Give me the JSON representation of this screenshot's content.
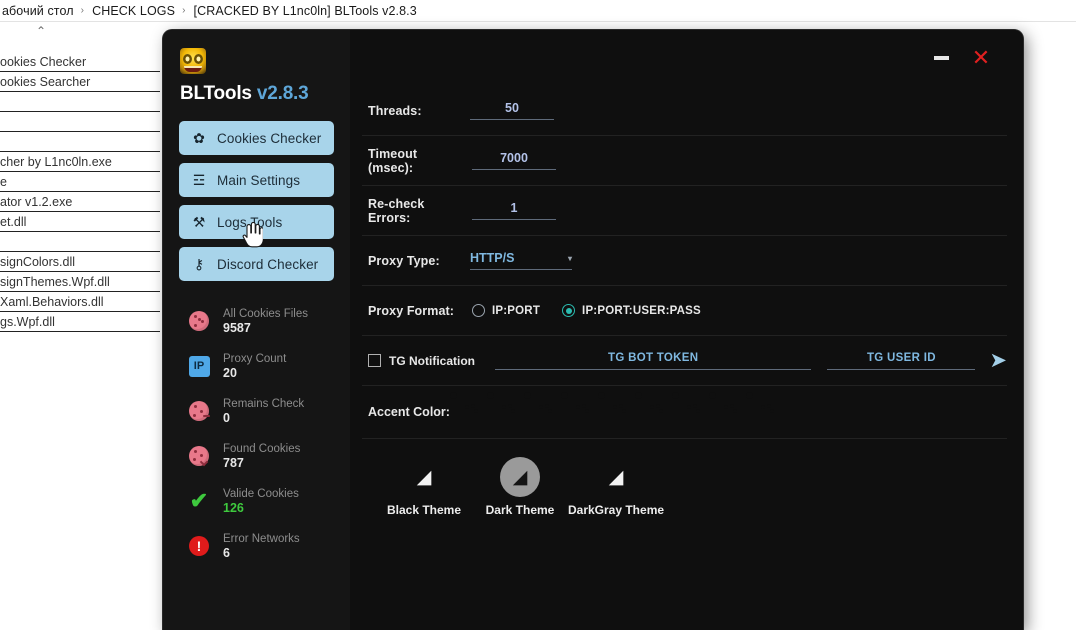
{
  "explorer": {
    "breadcrumb": [
      "абочий стол",
      "CHECK LOGS",
      "[CRACKED BY L1nc0ln] BLTools v2.8.3"
    ],
    "separator": "›",
    "collapse_icon": "⌃",
    "files": [
      "ookies Checker",
      "ookies Searcher",
      "",
      "",
      "",
      "cher by L1nc0ln.exe",
      "e",
      "ator v1.2.exe",
      "et.dll",
      "",
      "signColors.dll",
      "signThemes.Wpf.dll",
      "Xaml.Behaviors.dll",
      "gs.Wpf.dll"
    ]
  },
  "app": {
    "logo_icon": "emoji-face-icon",
    "title": "BLTools",
    "version": "v2.8.3",
    "window_controls": {
      "minimize": "minimize-icon",
      "close": "✕"
    },
    "nav": [
      {
        "label": "Cookies Checker",
        "icon": "✿",
        "icon_name": "cookie-icon"
      },
      {
        "label": "Main Settings",
        "icon": "☲",
        "icon_name": "sliders-icon"
      },
      {
        "label": "Logs Tools",
        "icon": "⚒",
        "icon_name": "tools-icon"
      },
      {
        "label": "Discord Checker",
        "icon": "⚷",
        "icon_name": "key-icon"
      }
    ],
    "stats": [
      {
        "label": "All Cookies Files",
        "value": "9587",
        "icon_name": "cookie-icon",
        "style": "cookie"
      },
      {
        "label": "Proxy Count",
        "value": "20",
        "icon_name": "ip-badge-icon",
        "style": "ip",
        "badge_text": "IP"
      },
      {
        "label": "Remains Check",
        "value": "0",
        "icon_name": "cookie-minus-icon",
        "style": "cookie"
      },
      {
        "label": "Found Cookies",
        "value": "787",
        "icon_name": "cookie-check-icon",
        "style": "cookie"
      },
      {
        "label": "Valide Cookies",
        "value": "126",
        "icon_name": "checkmark-icon",
        "style": "check",
        "glyph": "✔"
      },
      {
        "label": "Error Networks",
        "value": "6",
        "icon_name": "error-circle-icon",
        "style": "error",
        "glyph": "!"
      }
    ],
    "form": {
      "threads": {
        "label": "Threads:",
        "value": "50"
      },
      "timeout": {
        "label": "Timeout (msec):",
        "value": "7000"
      },
      "recheck": {
        "label": "Re-check Errors:",
        "value": "1"
      },
      "proxy_type": {
        "label": "Proxy Type:",
        "value": "HTTP/S",
        "caret": "▾"
      },
      "proxy_format": {
        "label": "Proxy Format:",
        "options": [
          "IP:PORT",
          "IP:PORT:USER:PASS"
        ],
        "selected_index": 1
      },
      "tg": {
        "checkbox_label": "TG Notification",
        "checked": false,
        "bot_token_placeholder": "TG BOT TOKEN",
        "bot_token_value": "",
        "user_id_placeholder": "TG USER ID",
        "user_id_value": "",
        "send_icon": "➤"
      }
    },
    "accent": {
      "label": "Accent Color:",
      "colors": [
        "#6b9dbd",
        "#9ae89a",
        "#2fb8a0",
        "#e8788a",
        "#f0a080",
        "#b05ce0",
        "#ffffff",
        "#2ecc2e",
        "#c41020"
      ]
    },
    "themes": {
      "icon": "◢",
      "items": [
        {
          "name": "Black Theme",
          "selected": false
        },
        {
          "name": "Dark Theme",
          "selected": true
        },
        {
          "name": "DarkGray Theme",
          "selected": false
        }
      ]
    }
  }
}
